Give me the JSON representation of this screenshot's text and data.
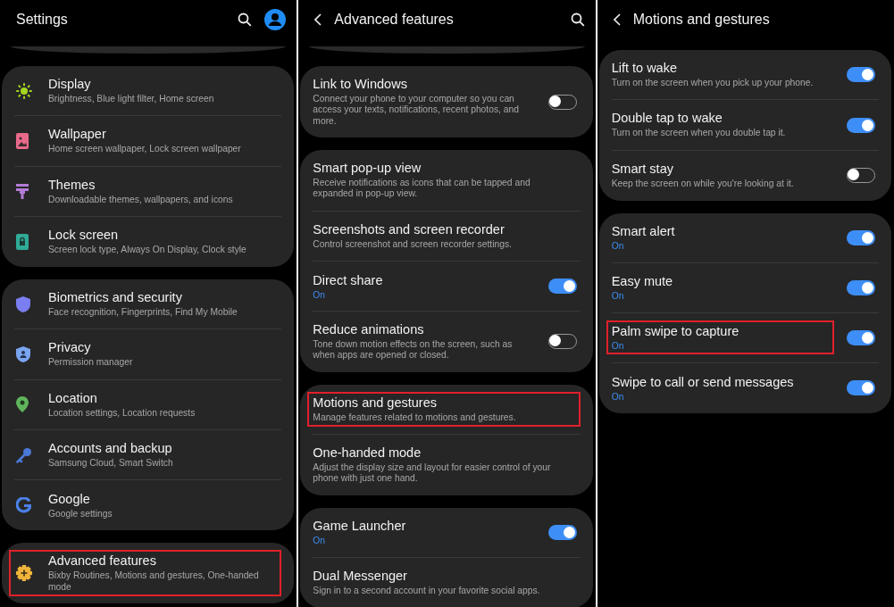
{
  "screens": [
    {
      "title": "Settings",
      "back": false,
      "search": true,
      "profile": true,
      "icons": true,
      "scrolled_top": true,
      "groups": [
        {
          "items": [
            {
              "title": "Display",
              "summary": "Brightness, Blue light filter, Home screen",
              "highlighted": false
            },
            {
              "title": "Wallpaper",
              "summary": "Home screen wallpaper, Lock screen wallpaper",
              "highlighted": false
            },
            {
              "title": "Themes",
              "summary": "Downloadable themes, wallpapers, and icons",
              "highlighted": false
            },
            {
              "title": "Lock screen",
              "summary": "Screen lock type, Always On Display, Clock style",
              "highlighted": false
            }
          ]
        },
        {
          "items": [
            {
              "title": "Biometrics and security",
              "summary": "Face recognition, Fingerprints, Find My Mobile",
              "highlighted": false
            },
            {
              "title": "Privacy",
              "summary": "Permission manager",
              "highlighted": false
            },
            {
              "title": "Location",
              "summary": "Location settings, Location requests",
              "highlighted": false
            },
            {
              "title": "Accounts and backup",
              "summary": "Samsung Cloud, Smart Switch",
              "highlighted": false
            },
            {
              "title": "Google",
              "summary": "Google settings",
              "highlighted": false
            }
          ]
        },
        {
          "items": [
            {
              "title": "Advanced features",
              "summary": "Bixby Routines, Motions and gestures, One-handed mode",
              "highlighted": true
            }
          ]
        }
      ]
    },
    {
      "title": "Advanced features",
      "back": true,
      "search": true,
      "profile": false,
      "icons": false,
      "scrolled_top": true,
      "groups": [
        {
          "items": [
            {
              "title": "Link to Windows",
              "summary": "Connect your phone to your computer so you can access your texts, notifications, recent photos, and more.",
              "on": false,
              "highlighted": false
            }
          ]
        },
        {
          "items": [
            {
              "title": "Smart pop-up view",
              "summary": "Receive notifications as icons that can be tapped and expanded in pop-up view.",
              "highlighted": false
            },
            {
              "title": "Screenshots and screen recorder",
              "summary": "Control screenshot and screen recorder settings.",
              "highlighted": false
            },
            {
              "title": "Direct share",
              "status": "On",
              "on": true,
              "highlighted": false
            },
            {
              "title": "Reduce animations",
              "summary": "Tone down motion effects on the screen, such as when apps are opened or closed.",
              "on": false,
              "highlighted": false
            }
          ]
        },
        {
          "items": [
            {
              "title": "Motions and gestures",
              "summary": "Manage features related to motions and gestures.",
              "highlighted": true
            },
            {
              "title": "One-handed mode",
              "summary": "Adjust the display size and layout for easier control of your phone with just one hand.",
              "highlighted": false
            }
          ]
        },
        {
          "items": [
            {
              "title": "Game Launcher",
              "status": "On",
              "on": true,
              "highlighted": false
            },
            {
              "title": "Dual Messenger",
              "summary": "Sign in to a second account in your favorite social apps.",
              "highlighted": false
            }
          ]
        }
      ]
    },
    {
      "title": "Motions and gestures",
      "back": true,
      "search": false,
      "profile": false,
      "icons": false,
      "scrolled_top": false,
      "groups": [
        {
          "items": [
            {
              "title": "Lift to wake",
              "summary": "Turn on the screen when you pick up your phone.",
              "on": true,
              "highlighted": false
            },
            {
              "title": "Double tap to wake",
              "summary": "Turn on the screen when you double tap it.",
              "on": true,
              "highlighted": false
            },
            {
              "title": "Smart stay",
              "summary": "Keep the screen on while you're looking at it.",
              "on": false,
              "highlighted": false
            }
          ]
        },
        {
          "items": [
            {
              "title": "Smart alert",
              "status": "On",
              "on": true,
              "highlighted": false
            },
            {
              "title": "Easy mute",
              "status": "On",
              "on": true,
              "highlighted": false
            },
            {
              "title": "Palm swipe to capture",
              "status": "On",
              "on": true,
              "highlighted": true
            },
            {
              "title": "Swipe to call or send messages",
              "status": "On",
              "on": true,
              "highlighted": false
            }
          ]
        }
      ]
    }
  ]
}
